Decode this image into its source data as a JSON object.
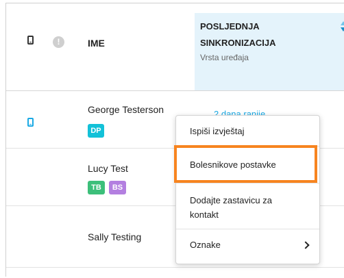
{
  "header": {
    "alert_symbol": "!",
    "name_label": "IME",
    "sync_title": "POSLJEDNJA SINKRONIZACIJA",
    "sync_subtitle": "Vrsta uređaja"
  },
  "rows": [
    {
      "name": "George Testerson",
      "tags": [
        {
          "text": "DP",
          "color": "#13c1d8"
        }
      ],
      "sync": "2 dana ranije"
    },
    {
      "name": "Lucy Test",
      "tags": [
        {
          "text": "TB",
          "color": "#3cbf7a"
        },
        {
          "text": "BS",
          "color": "#b37fe0"
        }
      ]
    },
    {
      "name": "Sally Testing",
      "tags": []
    }
  ],
  "context_menu": {
    "items": [
      "Ispiši izvještaj",
      "Bolesnikove postavke",
      "Dodajte zastavicu za kontakt",
      "Oznake"
    ],
    "highlighted_index": 1,
    "highlight_color": "#f7841f"
  },
  "colors": {
    "accent": "#1aa9e4",
    "header_highlight_bg": "#e4f3fb"
  }
}
